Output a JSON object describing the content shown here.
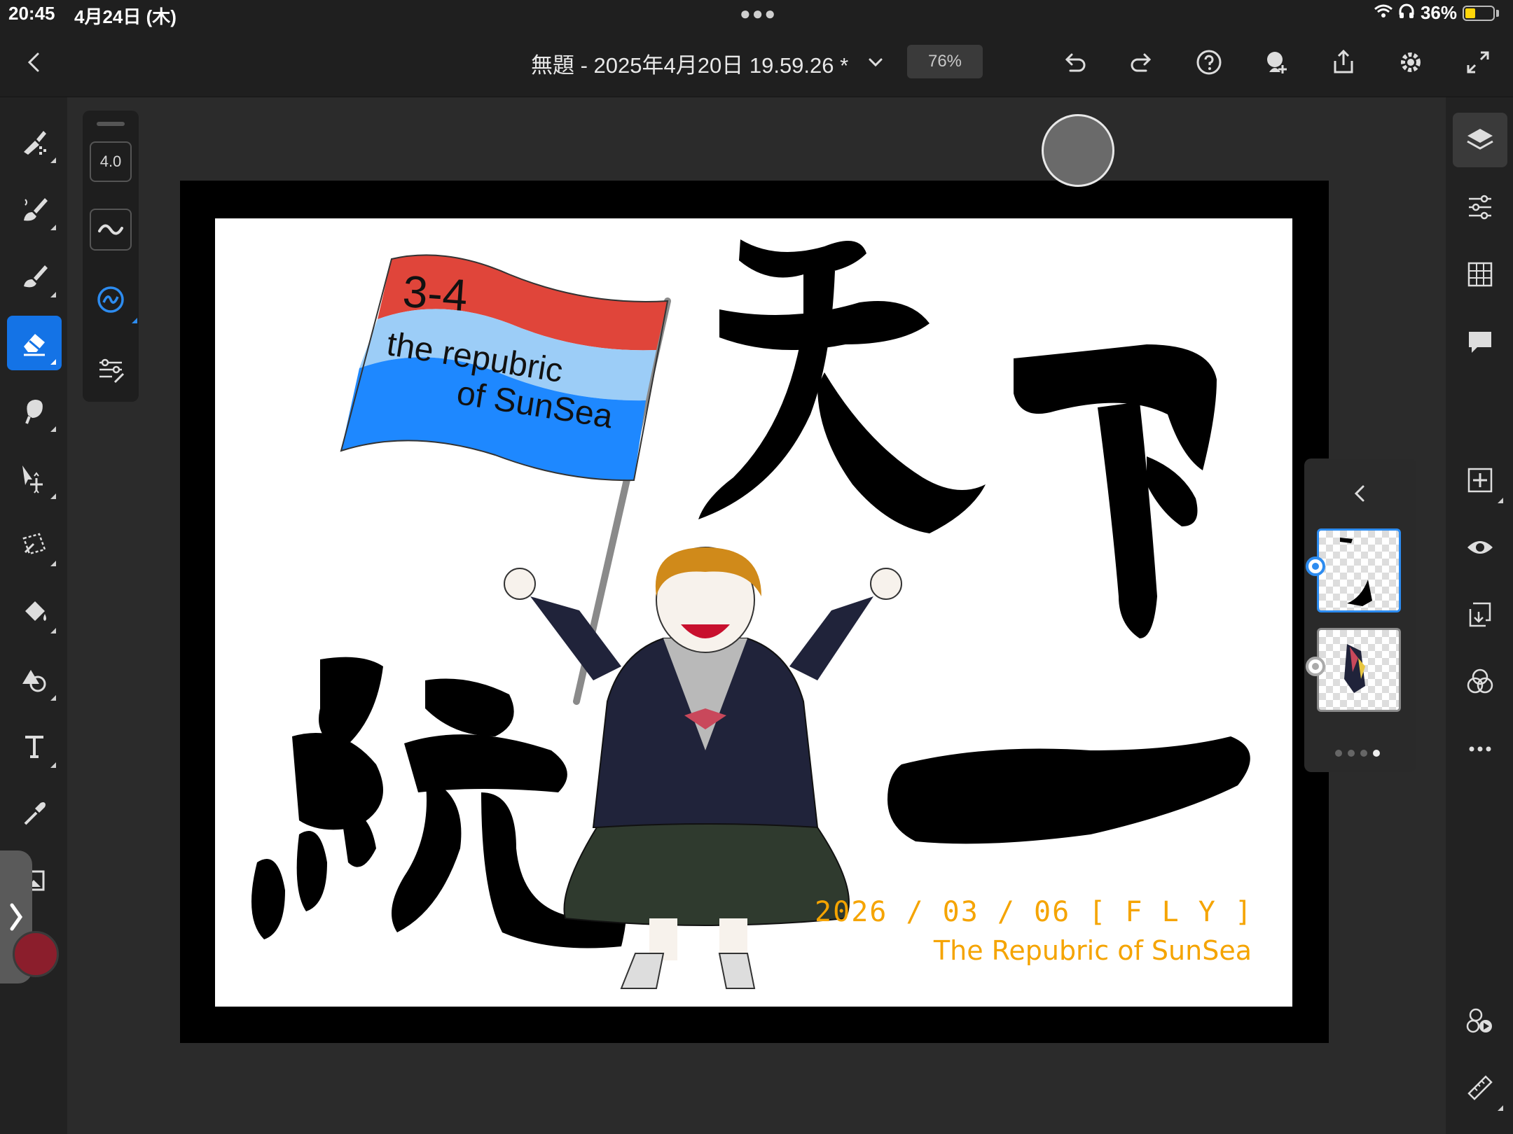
{
  "status_bar": {
    "time": "20:45",
    "date": "4月24日 (木)",
    "battery": "36%",
    "battery_level": 0.36
  },
  "top_bar": {
    "document_title": "無題 - 2025年4月20日 19.59.26 *",
    "zoom": "76%",
    "icons": [
      "back-icon",
      "title-dropdown-icon",
      "undo-icon",
      "redo-icon",
      "help-icon",
      "invite-icon",
      "share-icon",
      "settings-icon",
      "fullscreen-icon"
    ]
  },
  "brush_panel": {
    "size": "4.0",
    "icons": [
      "smoothing-icon",
      "pressure-icon",
      "brush-settings-icon"
    ]
  },
  "left_tools": [
    "pixel-brush-icon",
    "live-brush-icon",
    "vector-brush-icon",
    "eraser-icon",
    "smudge-icon",
    "transform-icon",
    "selection-icon",
    "fill-icon",
    "shape-icon",
    "text-icon",
    "eyedropper-icon",
    "image-icon"
  ],
  "right_tools": [
    "layers-icon",
    "properties-icon",
    "grid-icon",
    "comments-icon",
    "add-layer-icon",
    "visibility-icon",
    "merge-icon",
    "blend-icon",
    "more-icon",
    "timelapse-icon",
    "ruler-icon"
  ],
  "artwork": {
    "flag_number": "3-4",
    "flag_line1": "the repubric",
    "flag_line2": "of SunSea",
    "calligraphy": [
      "天",
      "下",
      "統",
      "一"
    ],
    "date_text": "2026 / 03 / 06 [ F L Y ]",
    "subtitle": "The Repubric of SunSea"
  },
  "layers": {
    "count": 2,
    "selected": 0,
    "page_dots": 4,
    "active_dot": 3
  },
  "colors": {
    "accent": "#1473e6",
    "current_color": "#8b1e2c",
    "flag_red": "#e0453a",
    "flag_lightblue": "#9ccdf7",
    "flag_blue": "#1e88ff",
    "text_orange": "#f5a400"
  }
}
